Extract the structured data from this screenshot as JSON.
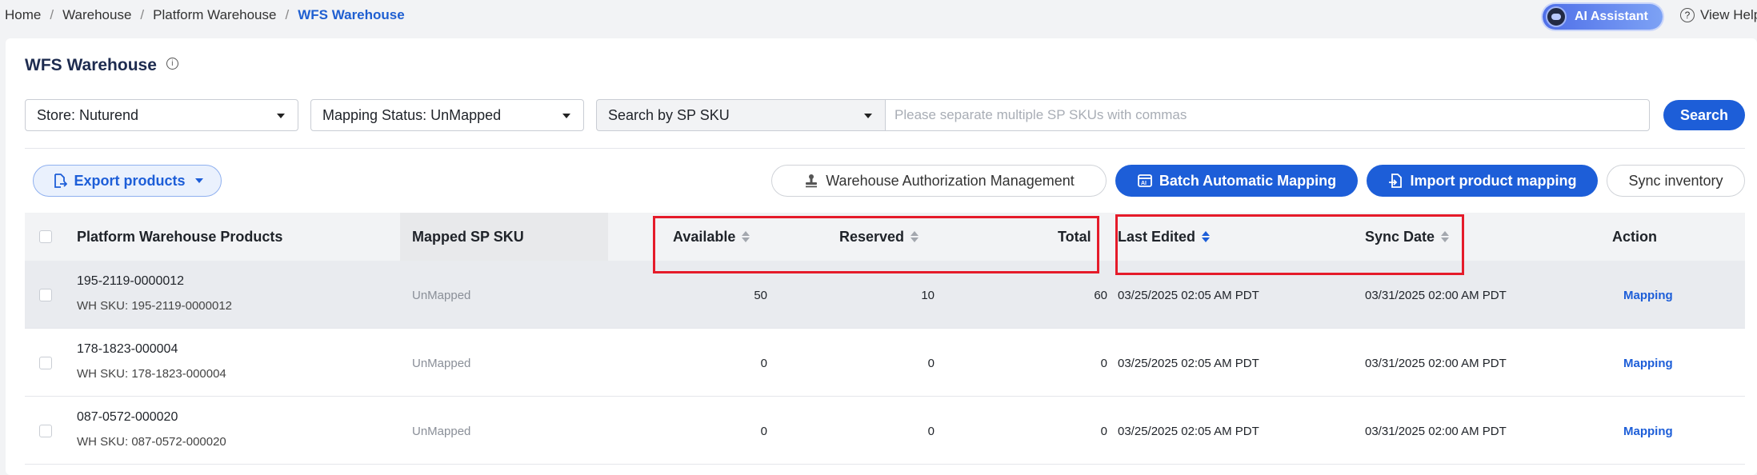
{
  "breadcrumb": [
    "Home",
    "Warehouse",
    "Platform Warehouse",
    "WFS Warehouse"
  ],
  "header": {
    "ai_assistant": "AI Assistant",
    "view_help": "View Help"
  },
  "page": {
    "title": "WFS Warehouse"
  },
  "filters": {
    "store": "Store: Nuturend",
    "mapping_status": "Mapping Status: UnMapped",
    "search_by": "Search by SP SKU",
    "search_placeholder": "Please separate multiple SP SKUs with commas",
    "search_button": "Search"
  },
  "actions": {
    "export": "Export products",
    "warehouse_auth": "Warehouse Authorization Management",
    "batch_mapping": "Batch Automatic Mapping",
    "import_mapping": "Import product mapping",
    "sync_inventory": "Sync inventory"
  },
  "table": {
    "columns": {
      "products": "Platform Warehouse Products",
      "mapped_sku": "Mapped SP SKU",
      "available": "Available",
      "reserved": "Reserved",
      "total": "Total",
      "last_edited": "Last Edited",
      "sync_date": "Sync Date",
      "action": "Action"
    },
    "rows": [
      {
        "product": "195-2119-0000012",
        "wh_sku": "WH SKU: 195-2119-0000012",
        "mapped": "UnMapped",
        "available": "50",
        "reserved": "10",
        "total": "60",
        "last_edited": "03/25/2025 02:05 AM PDT",
        "sync_date": "03/31/2025 02:00 AM PDT",
        "action": "Mapping"
      },
      {
        "product": "178-1823-000004",
        "wh_sku": "WH SKU: 178-1823-000004",
        "mapped": "UnMapped",
        "available": "0",
        "reserved": "0",
        "total": "0",
        "last_edited": "03/25/2025 02:05 AM PDT",
        "sync_date": "03/31/2025 02:00 AM PDT",
        "action": "Mapping"
      },
      {
        "product": "087-0572-000020",
        "wh_sku": "WH SKU: 087-0572-000020",
        "mapped": "UnMapped",
        "available": "0",
        "reserved": "0",
        "total": "0",
        "last_edited": "03/25/2025 02:05 AM PDT",
        "sync_date": "03/31/2025 02:00 AM PDT",
        "action": "Mapping"
      }
    ]
  },
  "colors": {
    "primary": "#1d5ed8",
    "highlight": "#e51b2a",
    "header_bg": "#f2f3f5"
  }
}
